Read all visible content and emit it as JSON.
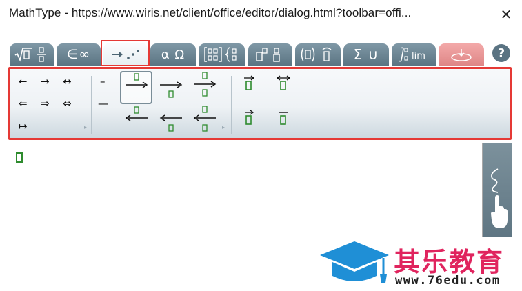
{
  "window": {
    "title": "MathType - https://www.wiris.net/client/office/editor/dialog.html?toolbar=offi...",
    "close_glyph": "✕"
  },
  "tabs": [
    {
      "name": "tab-general",
      "icon": "sqrt-fraction-icon",
      "label": "√▯ ▯/▯"
    },
    {
      "name": "tab-symbols",
      "icon": "set-infinity-icon",
      "label": "∈∞"
    },
    {
      "name": "tab-arrows",
      "icon": "arrows-icon",
      "label": "→⋰",
      "active": true
    },
    {
      "name": "tab-greek",
      "icon": "greek-icon",
      "label": "α Ω"
    },
    {
      "name": "tab-matrices",
      "icon": "matrix-icon",
      "label": "[▯] {▯"
    },
    {
      "name": "tab-scripts",
      "icon": "scripts-icon",
      "label": "▯▯ ▯"
    },
    {
      "name": "tab-decorations",
      "icon": "decorations-icon",
      "label": "(▯) ▯̂"
    },
    {
      "name": "tab-big-operators",
      "icon": "sum-union-icon",
      "label": "Σ ∪"
    },
    {
      "name": "tab-calculus",
      "icon": "integral-lim-icon",
      "label": "∫▯ lim"
    },
    {
      "name": "tab-contextual",
      "icon": "contextual-icon",
      "label": ""
    }
  ],
  "help_label": "?",
  "arrows_group1": [
    "←",
    "→",
    "↔",
    "⇐",
    "⇒",
    "⇔",
    "↦"
  ],
  "arrows_group2": [
    "–",
    "—"
  ],
  "watermark": {
    "title": "其乐教育",
    "url": "www.76edu.com"
  },
  "colors": {
    "tab": "#6a8391",
    "tab_active": "#f3f6f8",
    "tab_pink": "#e89090",
    "highlight": "#e53935",
    "placeholder_green": "#2e8b2e",
    "brand_pink": "#e0245e",
    "brand_blue": "#1f8fd6"
  }
}
